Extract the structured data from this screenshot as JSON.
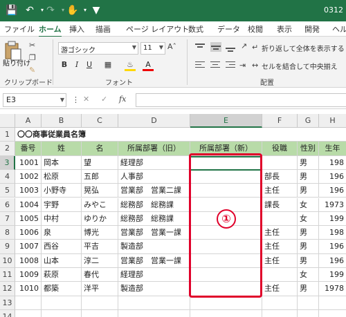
{
  "window": {
    "title_fragment": "0312"
  },
  "tabs": [
    "ファイル",
    "ホーム",
    "挿入",
    "描画",
    "ページ レイアウト",
    "数式",
    "データ",
    "校閲",
    "表示",
    "開発",
    "ヘルプ"
  ],
  "active_tab": "ホーム",
  "ribbon": {
    "paste_label": "貼り付け",
    "clipboard_label": "クリップボード",
    "font_name": "游ゴシック",
    "font_size": "11",
    "font_group_label": "フォント",
    "align_group_label": "配置",
    "wrap_text": "折り返して全体を表示する",
    "merge_center": "セルを結合して中央揃え",
    "bold": "B",
    "italic": "I",
    "underline": "U"
  },
  "formula_bar": {
    "name_box": "E3",
    "fx": "fx",
    "formula": ""
  },
  "columns": [
    "A",
    "B",
    "C",
    "D",
    "E",
    "F",
    "G",
    "H"
  ],
  "rows": [
    {
      "n": "1",
      "cells": [
        "〇〇商事従業員名簿",
        "",
        "",
        "",
        "",
        "",
        "",
        ""
      ]
    },
    {
      "n": "2",
      "cells": [
        "番号",
        "姓",
        "名",
        "所属部署（旧）",
        "所属部署（新）",
        "役職",
        "性別",
        "生年"
      ]
    },
    {
      "n": "3",
      "cells": [
        "1001",
        "岡本",
        "望",
        "経理部",
        "",
        "",
        "男",
        "198"
      ]
    },
    {
      "n": "4",
      "cells": [
        "1002",
        "松原",
        "五郎",
        "人事部",
        "",
        "部長",
        "男",
        "196"
      ]
    },
    {
      "n": "5",
      "cells": [
        "1003",
        "小野寺",
        "晃弘",
        "営業部　営業二課",
        "",
        "主任",
        "男",
        "196"
      ]
    },
    {
      "n": "6",
      "cells": [
        "1004",
        "宇野",
        "みやこ",
        "総務部　総務課",
        "",
        "課長",
        "女",
        "1973"
      ]
    },
    {
      "n": "7",
      "cells": [
        "1005",
        "中村",
        "ゆりか",
        "総務部　総務課",
        "",
        "",
        "女",
        "199"
      ]
    },
    {
      "n": "8",
      "cells": [
        "1006",
        "泉",
        "博光",
        "営業部　営業一課",
        "",
        "主任",
        "男",
        "198"
      ]
    },
    {
      "n": "9",
      "cells": [
        "1007",
        "西谷",
        "平吉",
        "製造部",
        "",
        "主任",
        "男",
        "196"
      ]
    },
    {
      "n": "10",
      "cells": [
        "1008",
        "山本",
        "淳二",
        "営業部　営業一課",
        "",
        "主任",
        "男",
        "196"
      ]
    },
    {
      "n": "11",
      "cells": [
        "1009",
        "萩原",
        "春代",
        "経理部",
        "",
        "",
        "女",
        "199"
      ]
    },
    {
      "n": "12",
      "cells": [
        "1010",
        "都築",
        "洋平",
        "製造部",
        "",
        "主任",
        "男",
        "1978"
      ]
    },
    {
      "n": "13",
      "cells": [
        "",
        "",
        "",
        "",
        "",
        "",
        "",
        ""
      ]
    },
    {
      "n": "14",
      "cells": [
        "",
        "",
        "",
        "",
        "",
        "",
        "",
        ""
      ]
    }
  ],
  "annotation": {
    "label": "①",
    "color": "#e0002a"
  },
  "colors": {
    "accent": "#217346",
    "header_fill": "#b8dba8"
  }
}
